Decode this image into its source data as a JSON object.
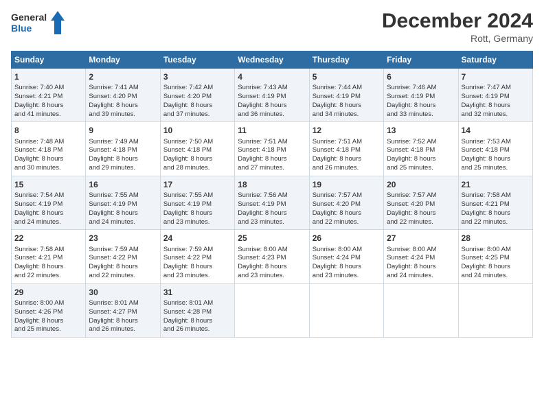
{
  "header": {
    "logo_line1": "General",
    "logo_line2": "Blue",
    "title": "December 2024",
    "subtitle": "Rott, Germany"
  },
  "days_of_week": [
    "Sunday",
    "Monday",
    "Tuesday",
    "Wednesday",
    "Thursday",
    "Friday",
    "Saturday"
  ],
  "weeks": [
    [
      {
        "day": 1,
        "lines": [
          "Sunrise: 7:40 AM",
          "Sunset: 4:21 PM",
          "Daylight: 8 hours",
          "and 41 minutes."
        ]
      },
      {
        "day": 2,
        "lines": [
          "Sunrise: 7:41 AM",
          "Sunset: 4:20 PM",
          "Daylight: 8 hours",
          "and 39 minutes."
        ]
      },
      {
        "day": 3,
        "lines": [
          "Sunrise: 7:42 AM",
          "Sunset: 4:20 PM",
          "Daylight: 8 hours",
          "and 37 minutes."
        ]
      },
      {
        "day": 4,
        "lines": [
          "Sunrise: 7:43 AM",
          "Sunset: 4:19 PM",
          "Daylight: 8 hours",
          "and 36 minutes."
        ]
      },
      {
        "day": 5,
        "lines": [
          "Sunrise: 7:44 AM",
          "Sunset: 4:19 PM",
          "Daylight: 8 hours",
          "and 34 minutes."
        ]
      },
      {
        "day": 6,
        "lines": [
          "Sunrise: 7:46 AM",
          "Sunset: 4:19 PM",
          "Daylight: 8 hours",
          "and 33 minutes."
        ]
      },
      {
        "day": 7,
        "lines": [
          "Sunrise: 7:47 AM",
          "Sunset: 4:19 PM",
          "Daylight: 8 hours",
          "and 32 minutes."
        ]
      }
    ],
    [
      {
        "day": 8,
        "lines": [
          "Sunrise: 7:48 AM",
          "Sunset: 4:18 PM",
          "Daylight: 8 hours",
          "and 30 minutes."
        ]
      },
      {
        "day": 9,
        "lines": [
          "Sunrise: 7:49 AM",
          "Sunset: 4:18 PM",
          "Daylight: 8 hours",
          "and 29 minutes."
        ]
      },
      {
        "day": 10,
        "lines": [
          "Sunrise: 7:50 AM",
          "Sunset: 4:18 PM",
          "Daylight: 8 hours",
          "and 28 minutes."
        ]
      },
      {
        "day": 11,
        "lines": [
          "Sunrise: 7:51 AM",
          "Sunset: 4:18 PM",
          "Daylight: 8 hours",
          "and 27 minutes."
        ]
      },
      {
        "day": 12,
        "lines": [
          "Sunrise: 7:51 AM",
          "Sunset: 4:18 PM",
          "Daylight: 8 hours",
          "and 26 minutes."
        ]
      },
      {
        "day": 13,
        "lines": [
          "Sunrise: 7:52 AM",
          "Sunset: 4:18 PM",
          "Daylight: 8 hours",
          "and 25 minutes."
        ]
      },
      {
        "day": 14,
        "lines": [
          "Sunrise: 7:53 AM",
          "Sunset: 4:18 PM",
          "Daylight: 8 hours",
          "and 25 minutes."
        ]
      }
    ],
    [
      {
        "day": 15,
        "lines": [
          "Sunrise: 7:54 AM",
          "Sunset: 4:19 PM",
          "Daylight: 8 hours",
          "and 24 minutes."
        ]
      },
      {
        "day": 16,
        "lines": [
          "Sunrise: 7:55 AM",
          "Sunset: 4:19 PM",
          "Daylight: 8 hours",
          "and 24 minutes."
        ]
      },
      {
        "day": 17,
        "lines": [
          "Sunrise: 7:55 AM",
          "Sunset: 4:19 PM",
          "Daylight: 8 hours",
          "and 23 minutes."
        ]
      },
      {
        "day": 18,
        "lines": [
          "Sunrise: 7:56 AM",
          "Sunset: 4:19 PM",
          "Daylight: 8 hours",
          "and 23 minutes."
        ]
      },
      {
        "day": 19,
        "lines": [
          "Sunrise: 7:57 AM",
          "Sunset: 4:20 PM",
          "Daylight: 8 hours",
          "and 22 minutes."
        ]
      },
      {
        "day": 20,
        "lines": [
          "Sunrise: 7:57 AM",
          "Sunset: 4:20 PM",
          "Daylight: 8 hours",
          "and 22 minutes."
        ]
      },
      {
        "day": 21,
        "lines": [
          "Sunrise: 7:58 AM",
          "Sunset: 4:21 PM",
          "Daylight: 8 hours",
          "and 22 minutes."
        ]
      }
    ],
    [
      {
        "day": 22,
        "lines": [
          "Sunrise: 7:58 AM",
          "Sunset: 4:21 PM",
          "Daylight: 8 hours",
          "and 22 minutes."
        ]
      },
      {
        "day": 23,
        "lines": [
          "Sunrise: 7:59 AM",
          "Sunset: 4:22 PM",
          "Daylight: 8 hours",
          "and 22 minutes."
        ]
      },
      {
        "day": 24,
        "lines": [
          "Sunrise: 7:59 AM",
          "Sunset: 4:22 PM",
          "Daylight: 8 hours",
          "and 23 minutes."
        ]
      },
      {
        "day": 25,
        "lines": [
          "Sunrise: 8:00 AM",
          "Sunset: 4:23 PM",
          "Daylight: 8 hours",
          "and 23 minutes."
        ]
      },
      {
        "day": 26,
        "lines": [
          "Sunrise: 8:00 AM",
          "Sunset: 4:24 PM",
          "Daylight: 8 hours",
          "and 23 minutes."
        ]
      },
      {
        "day": 27,
        "lines": [
          "Sunrise: 8:00 AM",
          "Sunset: 4:24 PM",
          "Daylight: 8 hours",
          "and 24 minutes."
        ]
      },
      {
        "day": 28,
        "lines": [
          "Sunrise: 8:00 AM",
          "Sunset: 4:25 PM",
          "Daylight: 8 hours",
          "and 24 minutes."
        ]
      }
    ],
    [
      {
        "day": 29,
        "lines": [
          "Sunrise: 8:00 AM",
          "Sunset: 4:26 PM",
          "Daylight: 8 hours",
          "and 25 minutes."
        ]
      },
      {
        "day": 30,
        "lines": [
          "Sunrise: 8:01 AM",
          "Sunset: 4:27 PM",
          "Daylight: 8 hours",
          "and 26 minutes."
        ]
      },
      {
        "day": 31,
        "lines": [
          "Sunrise: 8:01 AM",
          "Sunset: 4:28 PM",
          "Daylight: 8 hours",
          "and 26 minutes."
        ]
      },
      null,
      null,
      null,
      null
    ]
  ]
}
